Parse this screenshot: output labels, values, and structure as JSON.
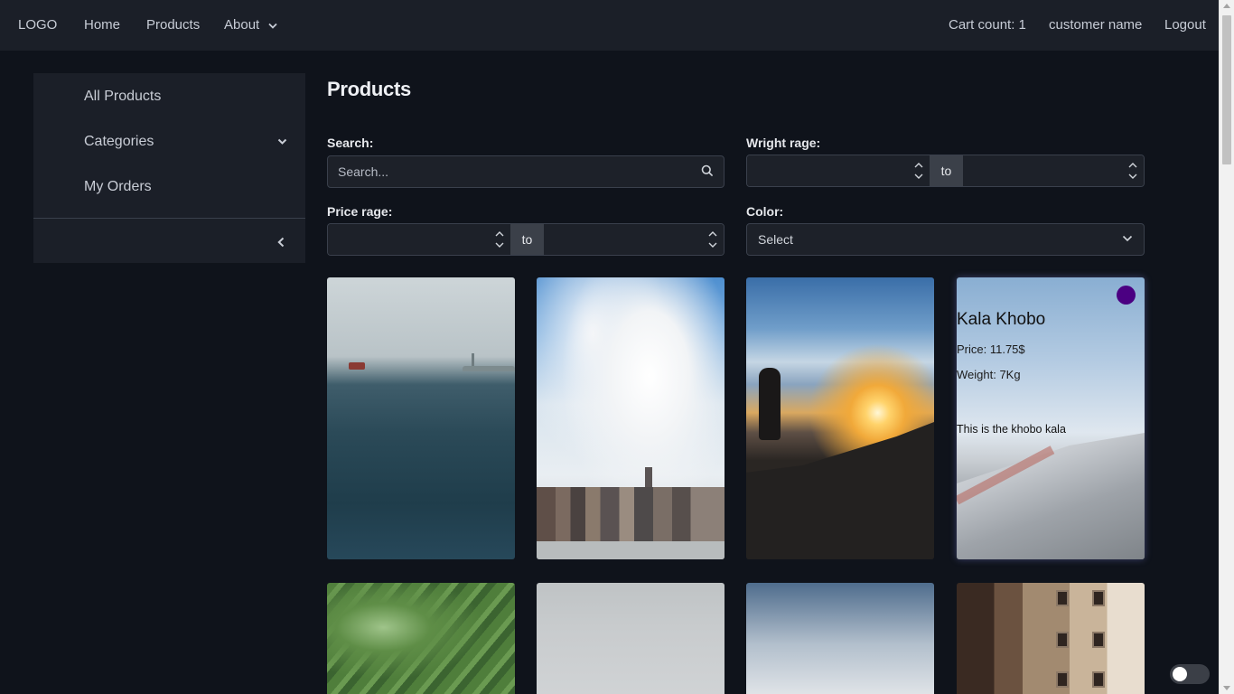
{
  "nav": {
    "logo": "LOGO",
    "home": "Home",
    "products": "Products",
    "about": "About",
    "cart": "Cart count: 1",
    "user": "customer name",
    "logout": "Logout"
  },
  "sidebar": {
    "items": [
      {
        "label": "All Products"
      },
      {
        "label": "Categories"
      },
      {
        "label": "My Orders"
      }
    ]
  },
  "main": {
    "title": "Products",
    "search": {
      "label": "Search:",
      "placeholder": "Search...",
      "value": ""
    },
    "weight": {
      "label": "Wright rage:",
      "to": "to",
      "from_value": "",
      "to_value": ""
    },
    "price": {
      "label": "Price rage:",
      "to": "to",
      "from_value": "",
      "to_value": ""
    },
    "color": {
      "label": "Color:",
      "selected": "Select"
    }
  },
  "products": [
    {
      "image": "sea"
    },
    {
      "image": "city"
    },
    {
      "image": "sunset"
    },
    {
      "image": "road",
      "name": "Kala Khobo",
      "price": "Price: 11.75$",
      "weight": "Weight: 7Kg",
      "description": "This is the khobo kala",
      "color": "#4b0082"
    },
    {
      "image": "beans"
    },
    {
      "image": "fog"
    },
    {
      "image": "cloud"
    },
    {
      "image": "building"
    }
  ],
  "theme_toggle": {
    "on": false
  },
  "colors": {
    "background": "#0f131b",
    "panel": "#1b1f28",
    "accent_dot": "#4b0082"
  }
}
